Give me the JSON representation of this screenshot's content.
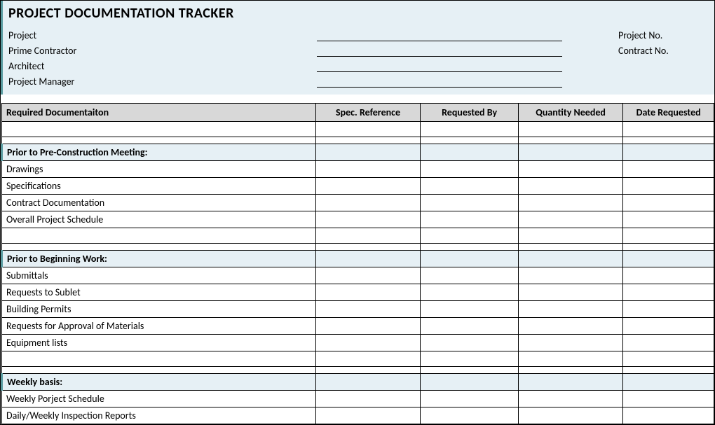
{
  "title": "PROJECT DOCUMENTATION TRACKER",
  "header": {
    "project_label": "Project",
    "prime_contractor_label": "Prime Contractor",
    "architect_label": "Architect",
    "project_manager_label": "Project Manager",
    "project_no_label": "Project No.",
    "contract_no_label": "Contract No."
  },
  "columns": {
    "doc": "Required Documentaiton",
    "spec": "Spec. Reference",
    "req_by": "Requested By",
    "qty": "Quantity Needed",
    "date": "Date Requested"
  },
  "sections": [
    {
      "title": "Prior to Pre-Construction Meeting:",
      "items": [
        "Drawings",
        "Specifications",
        "Contract Documentation",
        "Overall Project Schedule"
      ]
    },
    {
      "title": "Prior to Beginning Work:",
      "items": [
        "Submittals",
        "Requests to Sublet",
        "Building Permits",
        "Requests for Approval of Materials",
        "Equipment lists"
      ]
    },
    {
      "title": "Weekly basis:",
      "items": [
        "Weekly Porject Schedule",
        "Daily/Weekly Inspection Reports"
      ]
    }
  ]
}
